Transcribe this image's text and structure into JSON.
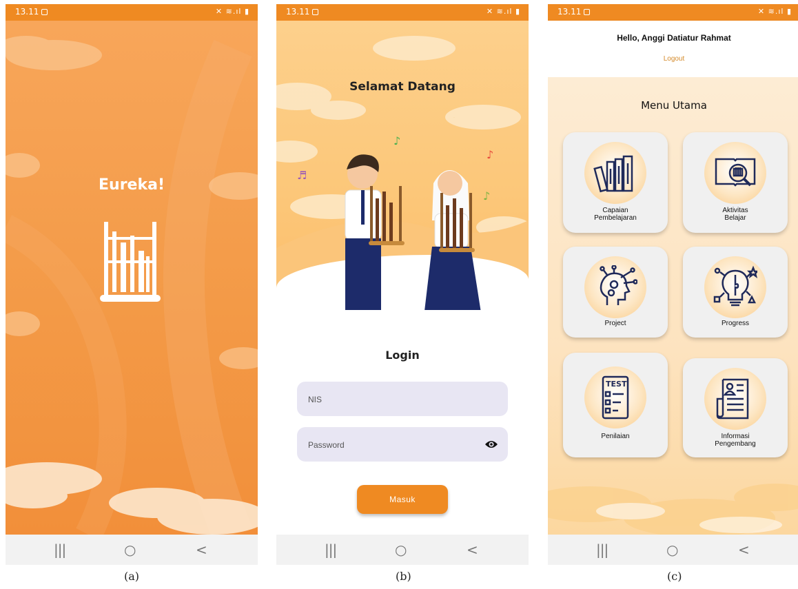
{
  "statusbar": {
    "time": "13.11",
    "icons": "✕ ≋.ıl ▮"
  },
  "splash": {
    "app_title": "Eureka!",
    "caption": "(a)"
  },
  "login": {
    "welcome": "Selamat Datang",
    "title": "Login",
    "nis_placeholder": "NIS",
    "password_placeholder": "Password",
    "submit_label": "Masuk",
    "caption": "(b)"
  },
  "menu": {
    "greeting": "Hello, Anggi Datiatur Rahmat",
    "logout": "Logout",
    "title": "Menu Utama",
    "items": [
      {
        "line1": "Capaian",
        "line2": "Pembelajaran"
      },
      {
        "line1": "Aktivitas",
        "line2": "Belajar"
      },
      {
        "line1": "Project",
        "line2": ""
      },
      {
        "line1": "Progress",
        "line2": ""
      },
      {
        "line1": "Penilaian",
        "line2": ""
      },
      {
        "line1": "Informasi",
        "line2": "Pengembang"
      }
    ],
    "test_text": "TEST",
    "caption": "(c)"
  },
  "colors": {
    "brand_orange": "#ef8a22",
    "icon_navy": "#1f2a5a",
    "field_bg": "#e8e6f3"
  }
}
